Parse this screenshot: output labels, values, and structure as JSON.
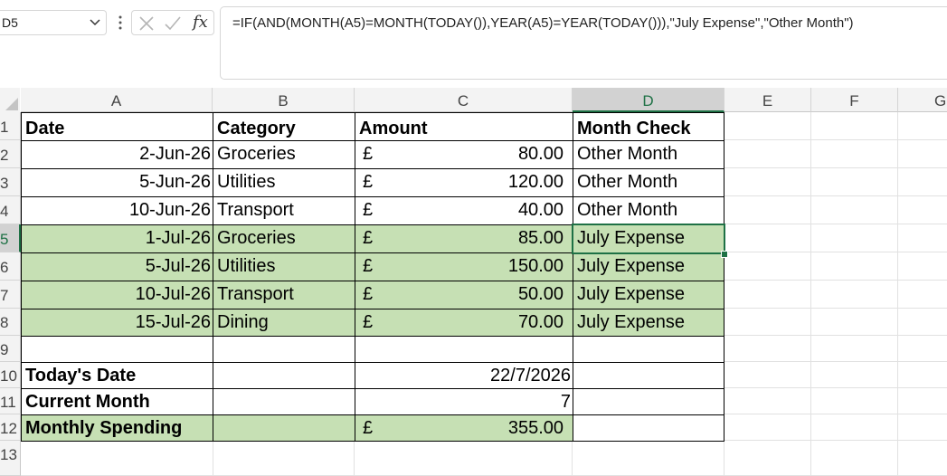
{
  "name_box": {
    "value": "D5"
  },
  "formula_bar": {
    "formula": "=IF(AND(MONTH(A5)=MONTH(TODAY()),YEAR(A5)=YEAR(TODAY())),\"July Expense\",\"Other Month\")",
    "fx_label": "fx"
  },
  "columns": [
    "A",
    "B",
    "C",
    "D",
    "E",
    "F",
    "G"
  ],
  "rows": [
    "1",
    "2",
    "3",
    "4",
    "5",
    "6",
    "7",
    "8",
    "9",
    "10",
    "11",
    "12",
    "13"
  ],
  "header": {
    "date": "Date",
    "category": "Category",
    "amount": "Amount",
    "month_check": "Month Check"
  },
  "data_rows": [
    {
      "date": "2-Jun-26",
      "category": "Groceries",
      "currency": "£",
      "amount": "80.00",
      "check": "Other Month",
      "highlight": false
    },
    {
      "date": "5-Jun-26",
      "category": "Utilities",
      "currency": "£",
      "amount": "120.00",
      "check": "Other Month",
      "highlight": false
    },
    {
      "date": "10-Jun-26",
      "category": "Transport",
      "currency": "£",
      "amount": "40.00",
      "check": "Other Month",
      "highlight": false
    },
    {
      "date": "1-Jul-26",
      "category": "Groceries",
      "currency": "£",
      "amount": "85.00",
      "check": "July Expense",
      "highlight": true
    },
    {
      "date": "5-Jul-26",
      "category": "Utilities",
      "currency": "£",
      "amount": "150.00",
      "check": "July Expense",
      "highlight": true
    },
    {
      "date": "10-Jul-26",
      "category": "Transport",
      "currency": "£",
      "amount": "50.00",
      "check": "July Expense",
      "highlight": true
    },
    {
      "date": "15-Jul-26",
      "category": "Dining",
      "currency": "£",
      "amount": "70.00",
      "check": "July Expense",
      "highlight": true
    }
  ],
  "summary": {
    "todays_date_label": "Today's Date",
    "todays_date_value": "22/7/2026",
    "current_month_label": "Current Month",
    "current_month_value": "7",
    "monthly_spending_label": "Monthly Spending",
    "monthly_spending_currency": "£",
    "monthly_spending_value": "355.00"
  },
  "colors": {
    "highlight": "#c6e0b4",
    "selection": "#1e7145"
  }
}
